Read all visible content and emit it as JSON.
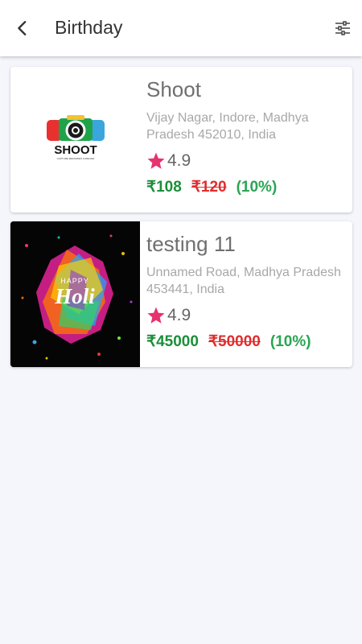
{
  "header": {
    "title": "Birthday",
    "back_icon": "chevron-left-icon",
    "filter_icon": "sliders-icon"
  },
  "listings": [
    {
      "name": "Shoot",
      "address": "Vijay Nagar, Indore, Madhya Pradesh 452010, India",
      "rating": "4.9",
      "price": "₹108",
      "original_price": "₹120",
      "discount": "(10%)",
      "image": {
        "logo_text": "SHOOT",
        "logo_tagline": "CAPTURE MEMORIES FOREVER"
      }
    },
    {
      "name": "testing 11",
      "address": "Unnamed Road, Madhya Pradesh 453441, India",
      "rating": "4.9",
      "price": "₹45000",
      "original_price": "₹50000",
      "discount": "(10%)",
      "image": {
        "line1": "HAPPY",
        "line2": "Holi"
      }
    }
  ],
  "colors": {
    "star": "#e53371",
    "price": "#1b8f3a",
    "original_price": "#e02d2d",
    "discount": "#2aa553",
    "background": "#f5f5fc"
  }
}
